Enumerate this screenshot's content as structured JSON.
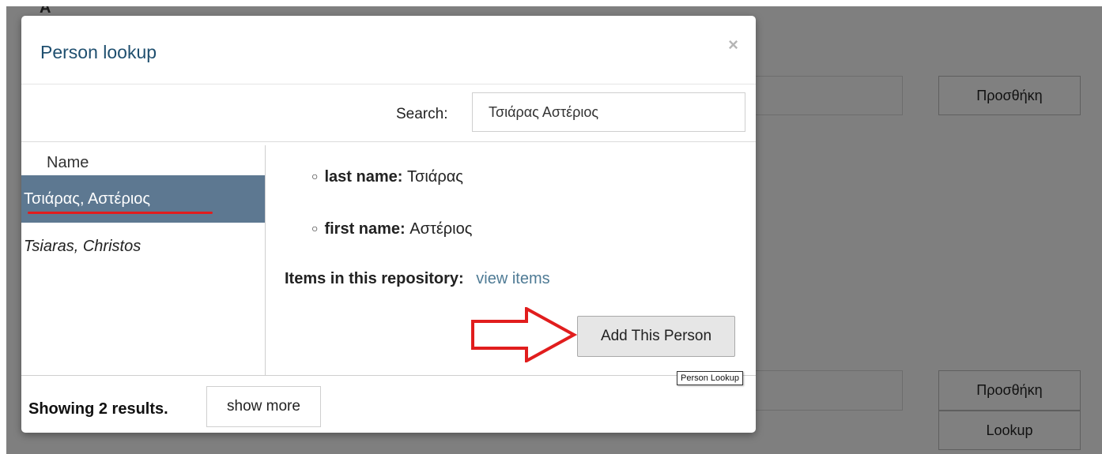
{
  "background": {
    "top_text": "Α",
    "buttons": {
      "add_top": "Προσθήκη",
      "add_bottom": "Προσθήκη",
      "lookup": "Lookup"
    }
  },
  "modal": {
    "title": "Person lookup",
    "close_symbol": "×",
    "search": {
      "label": "Search:",
      "value": "Τσιάρας Αστέριος"
    },
    "results": {
      "column_header": "Name",
      "items": [
        {
          "label": "Τσιάρας, Αστέριος"
        },
        {
          "label": "Tsiaras, Christos"
        }
      ]
    },
    "details": {
      "last_name_label": "last name:",
      "last_name_value": "Τσιάρας",
      "first_name_label": "first name:",
      "first_name_value": "Αστέριος",
      "items_label": "Items in this repository:",
      "items_link": "view items",
      "add_button": "Add This Person"
    },
    "footer": {
      "showing": "Showing 2 results.",
      "show_more": "show more"
    }
  },
  "tooltip": {
    "text": "Person Lookup"
  },
  "colors": {
    "selected_row": "#5d7891",
    "title": "#1f4f6f",
    "link": "#4f7b95",
    "annotation_red": "#e11d1d",
    "backdrop": "#7f7f7f"
  }
}
